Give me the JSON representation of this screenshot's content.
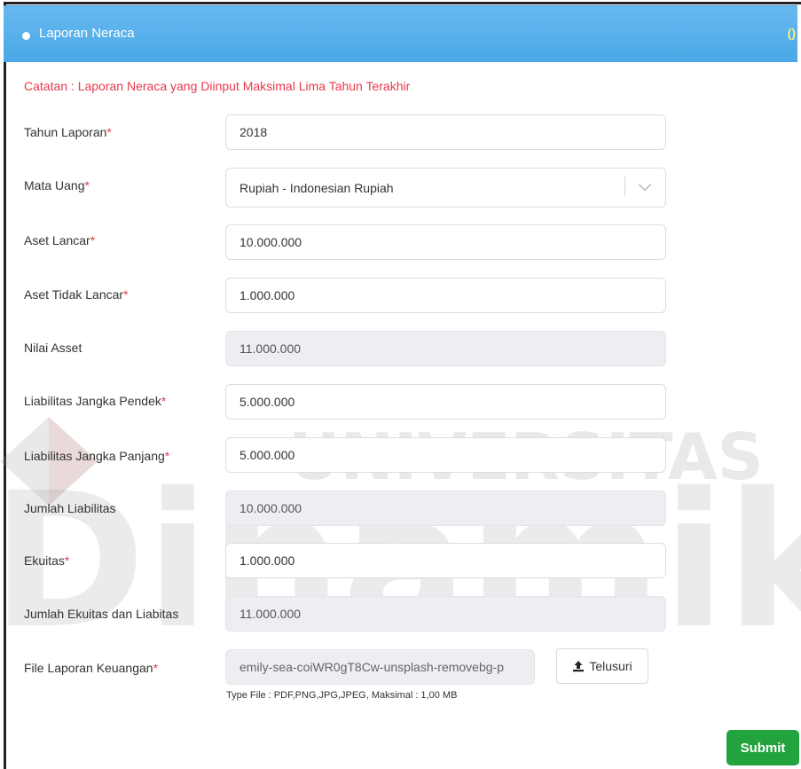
{
  "header": {
    "title": "Laporan Neraca",
    "badge": "()"
  },
  "note": "Catatan : Laporan Neraca yang Diinput Maksimal Lima Tahun Terakhir",
  "fields": {
    "tahun": {
      "label": "Tahun Laporan",
      "value": "2018"
    },
    "mata_uang": {
      "label": "Mata Uang",
      "value": "Rupiah - Indonesian Rupiah"
    },
    "aset_lancar": {
      "label": "Aset Lancar",
      "value": "10.000.000"
    },
    "aset_tidak_lancar": {
      "label": "Aset Tidak Lancar",
      "value": "1.000.000"
    },
    "nilai_asset": {
      "label": "Nilai Asset",
      "value": "11.000.000"
    },
    "liab_pendek": {
      "label": "Liabilitas Jangka Pendek",
      "value": "5.000.000"
    },
    "liab_panjang": {
      "label": "Liabilitas Jangka Panjang",
      "value": "5.000.000"
    },
    "jumlah_liab": {
      "label": "Jumlah Liabilitas",
      "value": "10.000.000"
    },
    "ekuitas": {
      "label": "Ekuitas",
      "value": "1.000.000"
    },
    "jumlah_ekuitas_liab": {
      "label": "Jumlah Ekuitas dan Liabitas",
      "value": "11.000.000"
    },
    "file": {
      "label": "File Laporan Keuangan",
      "value": "emily-sea-coiWR0gT8Cw-unsplash-removebg-p"
    }
  },
  "required_mark": "*",
  "browse_label": "Telusuri",
  "file_hint": "Type File : PDF,PNG,JPG,JPEG, Maksimal : 1,00 MB",
  "submit_label": "Submit",
  "watermark": {
    "top": "UNIVERSITAS",
    "bottom": "Dinamika"
  },
  "icons": {
    "header_bullet": "circle-icon",
    "select_arrow": "chevron-down-icon",
    "browse": "upload-icon"
  },
  "colors": {
    "header": "#4aa7e6",
    "required": "#e8394a",
    "submit": "#22a33d",
    "readonly": "#eceef1"
  }
}
